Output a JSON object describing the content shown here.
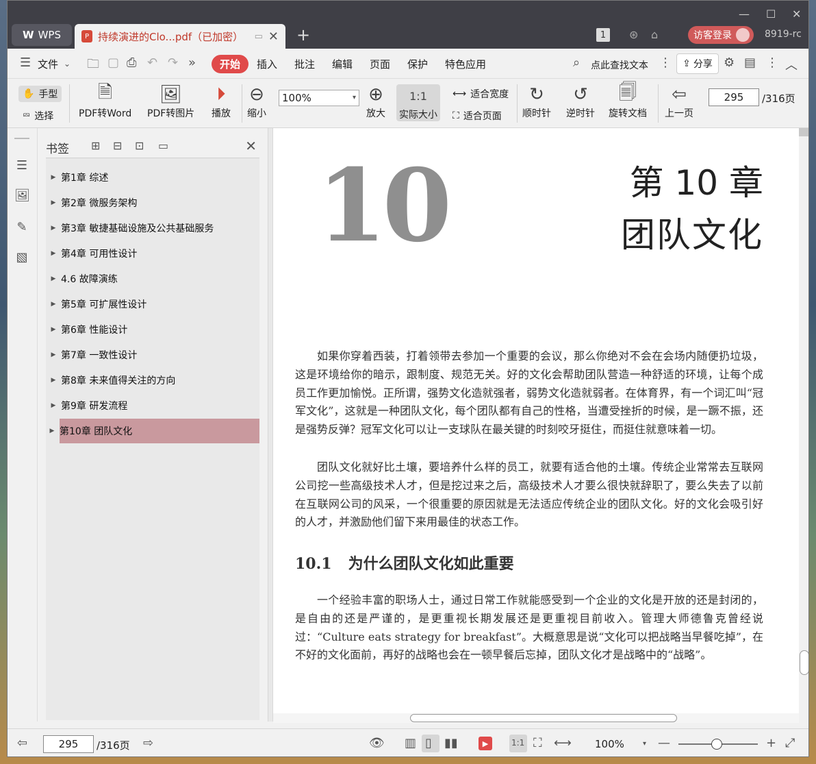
{
  "titlebar": {
    "app_tab": "WPS",
    "doc_tab": "持续演进的Clo...pdf（已加密）",
    "page_count_badge": "1",
    "login_label": "访客登录",
    "version": "8919-rc"
  },
  "menu": {
    "file": "文件",
    "items": [
      "开始",
      "插入",
      "批注",
      "编辑",
      "页面",
      "保护",
      "特色应用"
    ],
    "search_label": "点此查找文本",
    "share_label": "分享"
  },
  "toolbar": {
    "hand": "手型",
    "select": "选择",
    "pdf_to_word": "PDF转Word",
    "pdf_to_image": "PDF转图片",
    "play": "播放",
    "zoom_out": "缩小",
    "zoom_value": "100%",
    "zoom_in": "放大",
    "actual_size": "实际大小",
    "fit_width": "适合宽度",
    "fit_page": "适合页面",
    "clockwise": "顺时针",
    "counterclockwise": "逆时针",
    "rotate_doc": "旋转文档",
    "prev_page": "上一页",
    "page_current": "295",
    "page_total": "/316页"
  },
  "bookmarks": {
    "title": "书签",
    "items": [
      {
        "label": "第1章 综述"
      },
      {
        "label": "第2章 微服务架构"
      },
      {
        "label": "第3章 敏捷基础设施及公共基础服务"
      },
      {
        "label": "第4章 可用性设计"
      },
      {
        "label": "4.6 故障演练"
      },
      {
        "label": "第5章 可扩展性设计"
      },
      {
        "label": "第6章 性能设计"
      },
      {
        "label": "第7章 一致性设计"
      },
      {
        "label": "第8章 未来值得关注的方向"
      },
      {
        "label": "第9章 研发流程"
      },
      {
        "label": "第10章 团队文化",
        "selected": true
      }
    ]
  },
  "document": {
    "big_number": "10",
    "chapter_number": "第 10 章",
    "chapter_title": "团队文化",
    "para1": "如果你穿着西装，打着领带去参加一个重要的会议，那么你绝对不会在会场内随便扔垃圾，这是环境给你的暗示，跟制度、规范无关。好的文化会帮助团队营造一种舒适的环境，让每个成员工作更加愉悦。正所谓，强势文化造就强者，弱势文化造就弱者。在体育界，有一个词汇叫“冠军文化”，这就是一种团队文化，每个团队都有自己的性格，当遭受挫折的时候，是一蹶不振，还是强势反弹？冠军文化可以让一支球队在最关键的时刻咬牙挺住，而挺住就意味着一切。",
    "para2": "团队文化就好比土壤，要培养什么样的员工，就要有适合他的土壤。传统企业常常去互联网公司挖一些高级技术人才，但是挖过来之后，高级技术人才要么很快就辞职了，要么失去了以前在互联网公司的风采，一个很重要的原因就是无法适应传统企业的团队文化。好的文化会吸引好的人才，并激励他们留下来用最佳的状态工作。",
    "section_number": "10.1",
    "section_title": "为什么团队文化如此重要",
    "para3": "一个经验丰富的职场人士，通过日常工作就能感受到一个企业的文化是开放的还是封闭的，是自由的还是严谨的，是更重视长期发展还是更重视目前收入。管理大师德鲁克曾经说过：“Culture eats strategy for breakfast”。大概意思是说“文化可以把战略当早餐吃掉”，在不好的文化面前，再好的战略也会在一顿早餐后忘掉，团队文化才是战略中的“战略”。"
  },
  "statusbar": {
    "page_current": "295",
    "page_total": "/316页",
    "zoom": "100%"
  }
}
